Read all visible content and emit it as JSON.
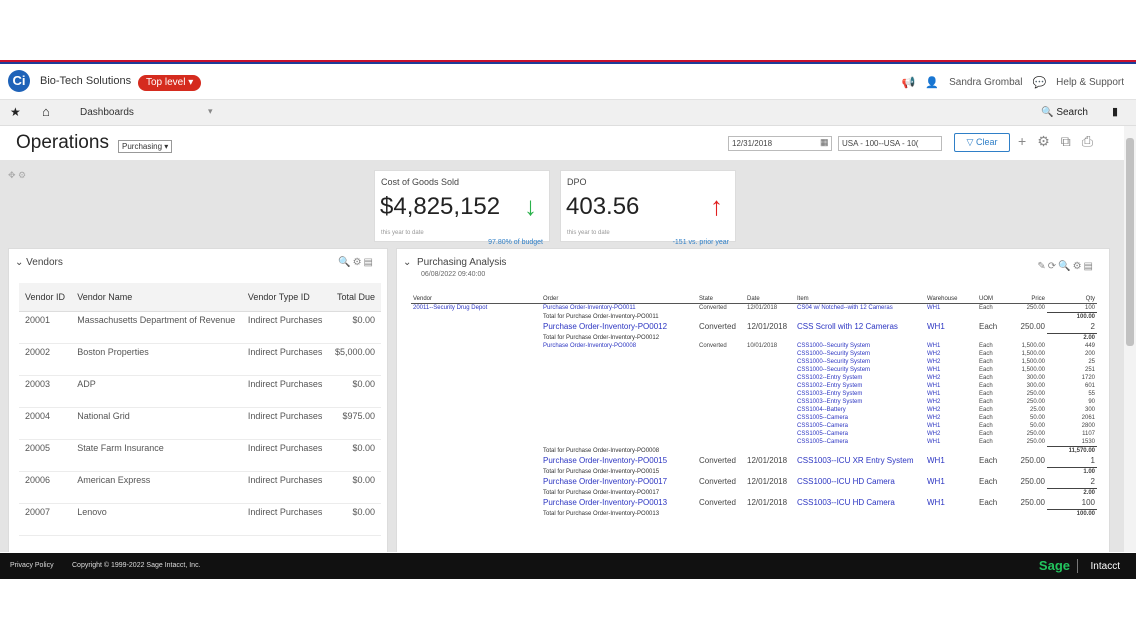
{
  "header": {
    "logo_letter": "Ci",
    "company": "Bio-Tech Solutions",
    "level": "Top level",
    "user": "Sandra Grombal",
    "help": "Help & Support"
  },
  "nav": {
    "dashboards": "Dashboards",
    "search": "Search"
  },
  "page": {
    "title": "Operations",
    "view_select": "Purchasing",
    "date": "12/31/2018",
    "location": "USA - 100--USA - 10(",
    "clear": "Clear"
  },
  "kpis": [
    {
      "title": "Cost of Goods Sold",
      "value": "$4,825,152",
      "arrow": "↓",
      "arrow_color": "#2bb24c",
      "sub": "this year to date",
      "cmp": "97.80% of budget"
    },
    {
      "title": "DPO",
      "value": "403.56",
      "arrow": "↑",
      "arrow_color": "#e02020",
      "sub": "this year to date",
      "cmp": "-151 vs. prior year"
    }
  ],
  "vendors": {
    "title": "Vendors",
    "columns": [
      "Vendor ID",
      "Vendor Name",
      "Vendor Type ID",
      "Total Due"
    ],
    "rows": [
      {
        "id": "20001",
        "name": "Massachusetts Department of Revenue",
        "type": "Indirect Purchases",
        "due": "$0.00"
      },
      {
        "id": "20002",
        "name": "Boston Properties",
        "type": "Indirect Purchases",
        "due": "$5,000.00"
      },
      {
        "id": "20003",
        "name": "ADP",
        "type": "Indirect Purchases",
        "due": "$0.00"
      },
      {
        "id": "20004",
        "name": "National Grid",
        "type": "Indirect Purchases",
        "due": "$975.00"
      },
      {
        "id": "20005",
        "name": "State Farm Insurance",
        "type": "Indirect Purchases",
        "due": "$0.00"
      },
      {
        "id": "20006",
        "name": "American Express",
        "type": "Indirect Purchases",
        "due": "$0.00"
      },
      {
        "id": "20007",
        "name": "Lenovo",
        "type": "Indirect Purchases",
        "due": "$0.00"
      }
    ]
  },
  "analysis": {
    "title": "Purchasing Analysis",
    "subtitle": "06/08/2022 09:40:00",
    "columns": [
      "Vendor",
      "Order",
      "State",
      "Date",
      "Item",
      "Warehouse",
      "UOM",
      "Price",
      "Qty"
    ],
    "rows": [
      {
        "v": "20011--Security Drug Depot",
        "o": "Purchase Order-Inventory-PO0011",
        "s": "Converted",
        "d": "12/01/2018",
        "i": "CS04 w/ Notched--with 12 Cameras",
        "w": "WH1",
        "u": "Each",
        "p": "250.00",
        "q": "100"
      },
      {
        "v": "",
        "o": "Total for Purchase Order-Inventory-PO0011",
        "s": "",
        "d": "",
        "i": "",
        "w": "",
        "u": "",
        "p": "",
        "q": "100.00",
        "tot": true
      },
      {
        "v": "",
        "o": "Purchase Order-Inventory-PO0012",
        "s": "Converted",
        "d": "12/01/2018",
        "i": "CSS Scroll  with 12 Cameras",
        "w": "WH1",
        "u": "Each",
        "p": "250.00",
        "q": "2",
        "big": true
      },
      {
        "v": "",
        "o": "Total for Purchase Order-Inventory-PO0012",
        "s": "",
        "d": "",
        "i": "",
        "w": "",
        "u": "",
        "p": "",
        "q": "2.00",
        "tot": true
      },
      {
        "v": "",
        "o": "Purchase Order-Inventory-PO0008",
        "s": "Converted",
        "d": "10/01/2018",
        "i": "CSS1000--Security System",
        "w": "WH1",
        "u": "Each",
        "p": "1,500.00",
        "q": "449"
      },
      {
        "v": "",
        "o": "",
        "s": "",
        "d": "",
        "i": "CSS1000--Security System",
        "w": "WH2",
        "u": "Each",
        "p": "1,500.00",
        "q": "200"
      },
      {
        "v": "",
        "o": "",
        "s": "",
        "d": "",
        "i": "CSS1000--Security System",
        "w": "WH2",
        "u": "Each",
        "p": "1,500.00",
        "q": "25"
      },
      {
        "v": "",
        "o": "",
        "s": "",
        "d": "",
        "i": "CSS1000--Security System",
        "w": "WH1",
        "u": "Each",
        "p": "1,500.00",
        "q": "251"
      },
      {
        "v": "",
        "o": "",
        "s": "",
        "d": "",
        "i": "CSS1002--Entry System",
        "w": "WH2",
        "u": "Each",
        "p": "300.00",
        "q": "1720"
      },
      {
        "v": "",
        "o": "",
        "s": "",
        "d": "",
        "i": "CSS1002--Entry System",
        "w": "WH1",
        "u": "Each",
        "p": "300.00",
        "q": "601"
      },
      {
        "v": "",
        "o": "",
        "s": "",
        "d": "",
        "i": "CSS1003--Entry System",
        "w": "WH1",
        "u": "Each",
        "p": "250.00",
        "q": "55"
      },
      {
        "v": "",
        "o": "",
        "s": "",
        "d": "",
        "i": "CSS1003--Entry System",
        "w": "WH2",
        "u": "Each",
        "p": "250.00",
        "q": "90"
      },
      {
        "v": "",
        "o": "",
        "s": "",
        "d": "",
        "i": "CSS1004--Battery",
        "w": "WH2",
        "u": "Each",
        "p": "25.00",
        "q": "300"
      },
      {
        "v": "",
        "o": "",
        "s": "",
        "d": "",
        "i": "CSS1005--Camera",
        "w": "WH2",
        "u": "Each",
        "p": "50.00",
        "q": "2061"
      },
      {
        "v": "",
        "o": "",
        "s": "",
        "d": "",
        "i": "CSS1005--Camera",
        "w": "WH1",
        "u": "Each",
        "p": "50.00",
        "q": "2800"
      },
      {
        "v": "",
        "o": "",
        "s": "",
        "d": "",
        "i": "CSS1005--Camera",
        "w": "WH2",
        "u": "Each",
        "p": "250.00",
        "q": "1107"
      },
      {
        "v": "",
        "o": "",
        "s": "",
        "d": "",
        "i": "CSS1005--Camera",
        "w": "WH1",
        "u": "Each",
        "p": "250.00",
        "q": "1530"
      },
      {
        "v": "",
        "o": "Total for Purchase Order-Inventory-PO0008",
        "s": "",
        "d": "",
        "i": "",
        "w": "",
        "u": "",
        "p": "",
        "q": "11,570.00",
        "tot": true
      },
      {
        "v": "",
        "o": "Purchase Order-Inventory-PO0015",
        "s": "Converted",
        "d": "12/01/2018",
        "i": "CSS1003--ICU XR Entry System",
        "w": "WH1",
        "u": "Each",
        "p": "250.00",
        "q": "1",
        "big": true
      },
      {
        "v": "",
        "o": "Total for Purchase Order-Inventory-PO0015",
        "s": "",
        "d": "",
        "i": "",
        "w": "",
        "u": "",
        "p": "",
        "q": "1.00",
        "tot": true
      },
      {
        "v": "",
        "o": "Purchase Order-Inventory-PO0017",
        "s": "Converted",
        "d": "12/01/2018",
        "i": "CSS1000--ICU HD Camera",
        "w": "WH1",
        "u": "Each",
        "p": "250.00",
        "q": "2",
        "big": true
      },
      {
        "v": "",
        "o": "Total for Purchase Order-Inventory-PO0017",
        "s": "",
        "d": "",
        "i": "",
        "w": "",
        "u": "",
        "p": "",
        "q": "2.00",
        "tot": true
      },
      {
        "v": "",
        "o": "Purchase Order-Inventory-PO0013",
        "s": "Converted",
        "d": "12/01/2018",
        "i": "CSS1003--ICU HD Camera",
        "w": "WH1",
        "u": "Each",
        "p": "250.00",
        "q": "100",
        "big": true
      },
      {
        "v": "",
        "o": "Total for Purchase Order-Inventory-PO0013",
        "s": "",
        "d": "",
        "i": "",
        "w": "",
        "u": "",
        "p": "",
        "q": "100.00",
        "tot": true
      }
    ]
  },
  "footer": {
    "privacy": "Privacy Policy",
    "copyright": "Copyright © 1999-2022 Sage Intacct, Inc.",
    "brand": "Sage",
    "product": "Intacct"
  }
}
